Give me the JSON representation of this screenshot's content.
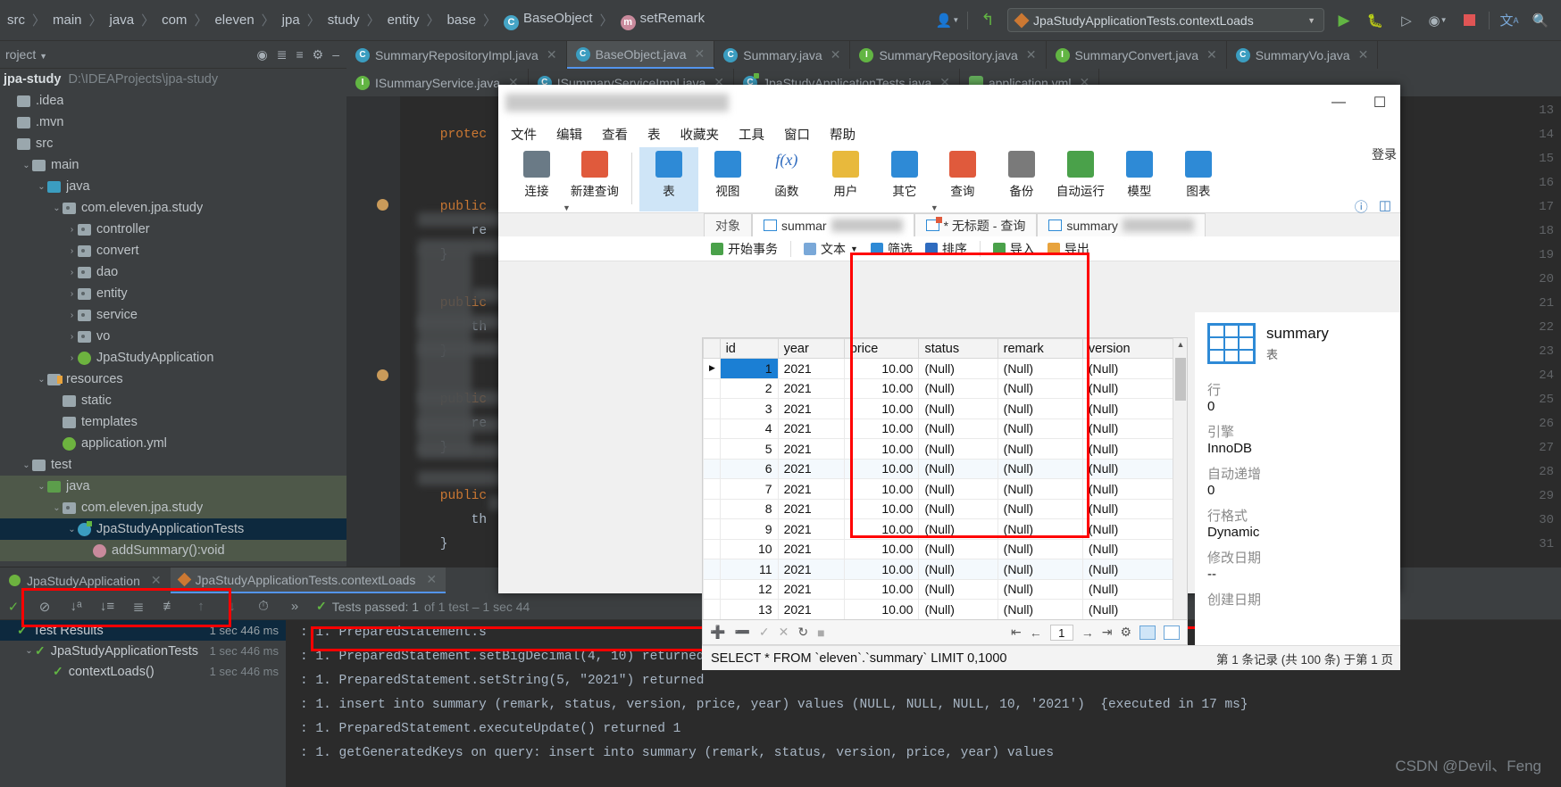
{
  "ide": {
    "breadcrumb": [
      {
        "label": "src",
        "icon": "none"
      },
      {
        "label": "main",
        "icon": "none"
      },
      {
        "label": "java",
        "icon": "none"
      },
      {
        "label": "com",
        "icon": "none"
      },
      {
        "label": "eleven",
        "icon": "none"
      },
      {
        "label": "jpa",
        "icon": "none"
      },
      {
        "label": "study",
        "icon": "none"
      },
      {
        "label": "entity",
        "icon": "none"
      },
      {
        "label": "base",
        "icon": "none"
      },
      {
        "label": "BaseObject",
        "icon": "class-icon"
      },
      {
        "label": "setRemark",
        "icon": "method-icon"
      }
    ],
    "run_config": "JpaStudyApplicationTests.contextLoads",
    "project_panel": {
      "title": "roject",
      "project_name": "jpa-study",
      "project_path": "D:\\IDEAProjects\\jpa-study"
    },
    "tree": [
      {
        "label": ".idea",
        "depth": 0,
        "arrow": "",
        "icon": "folder-grey"
      },
      {
        "label": ".mvn",
        "depth": 0,
        "arrow": "",
        "icon": "folder-grey"
      },
      {
        "label": "src",
        "depth": 0,
        "arrow": "",
        "icon": "folder-grey"
      },
      {
        "label": "main",
        "depth": 1,
        "arrow": "v",
        "icon": "folder-grey"
      },
      {
        "label": "java",
        "depth": 2,
        "arrow": "v",
        "icon": "folder-blue"
      },
      {
        "label": "com.eleven.jpa.study",
        "depth": 3,
        "arrow": "v",
        "icon": "package"
      },
      {
        "label": "controller",
        "depth": 4,
        "arrow": ">",
        "icon": "package"
      },
      {
        "label": "convert",
        "depth": 4,
        "arrow": ">",
        "icon": "package"
      },
      {
        "label": "dao",
        "depth": 4,
        "arrow": ">",
        "icon": "package"
      },
      {
        "label": "entity",
        "depth": 4,
        "arrow": ">",
        "icon": "package"
      },
      {
        "label": "service",
        "depth": 4,
        "arrow": ">",
        "icon": "package"
      },
      {
        "label": "vo",
        "depth": 4,
        "arrow": ">",
        "icon": "package"
      },
      {
        "label": "JpaStudyApplication",
        "depth": 4,
        "arrow": ">",
        "icon": "spring"
      },
      {
        "label": "resources",
        "depth": 2,
        "arrow": "v",
        "icon": "resources"
      },
      {
        "label": "static",
        "depth": 3,
        "arrow": "",
        "icon": "folder-grey"
      },
      {
        "label": "templates",
        "depth": 3,
        "arrow": "",
        "icon": "folder-grey"
      },
      {
        "label": "application.yml",
        "depth": 3,
        "arrow": "",
        "icon": "spring-yml"
      },
      {
        "label": "test",
        "depth": 1,
        "arrow": "v",
        "icon": "folder-grey"
      },
      {
        "label": "java",
        "depth": 2,
        "arrow": "v",
        "icon": "folder-green",
        "row_state": "sel-green"
      },
      {
        "label": "com.eleven.jpa.study",
        "depth": 3,
        "arrow": "v",
        "icon": "package",
        "row_state": "sel-green"
      },
      {
        "label": "JpaStudyApplicationTests",
        "depth": 4,
        "arrow": "v",
        "icon": "test-class",
        "row_state": "sel-blue"
      },
      {
        "label": "addSummary():void",
        "depth": 5,
        "arrow": "",
        "icon": "method",
        "row_state": "sel-green"
      }
    ],
    "tabs_row1": [
      {
        "label": "SummaryRepositoryImpl.java",
        "icon": "class-icon",
        "active": false
      },
      {
        "label": "BaseObject.java",
        "icon": "class-icon",
        "active": true
      },
      {
        "label": "Summary.java",
        "icon": "class-icon",
        "active": false
      },
      {
        "label": "SummaryRepository.java",
        "icon": "interface-icon",
        "active": false
      },
      {
        "label": "SummaryConvert.java",
        "icon": "interface-icon",
        "active": false
      },
      {
        "label": "SummaryVo.java",
        "icon": "class-icon",
        "active": false
      }
    ],
    "tabs_row2": [
      {
        "label": "ISummaryService.java",
        "icon": "interface-icon",
        "active": false
      },
      {
        "label": "ISummaryServiceImpl.java",
        "icon": "class-icon",
        "active": false
      },
      {
        "label": "JpaStudyApplicationTests.java",
        "icon": "test-class-icon",
        "active": false
      },
      {
        "label": "application.yml",
        "icon": "yml-icon",
        "active": false
      }
    ],
    "editor_lines": [
      {
        "num": "13",
        "text": ""
      },
      {
        "num": "14",
        "text": "    protec",
        "kw": "protec"
      },
      {
        "num": "15",
        "text": ""
      },
      {
        "num": "16",
        "text": ""
      },
      {
        "num": "17",
        "text": "    public",
        "kw": "public"
      },
      {
        "num": "18",
        "text": "        re"
      },
      {
        "num": "19",
        "text": "    }"
      },
      {
        "num": "20",
        "text": ""
      },
      {
        "num": "21",
        "text": "    public",
        "kw": "public"
      },
      {
        "num": "22",
        "text": "        th"
      },
      {
        "num": "23",
        "text": "    }"
      },
      {
        "num": "24",
        "text": ""
      },
      {
        "num": "25",
        "text": "    public",
        "kw": "public"
      },
      {
        "num": "26",
        "text": "        re"
      },
      {
        "num": "27",
        "text": "    }"
      },
      {
        "num": "28",
        "text": ""
      },
      {
        "num": "29",
        "text": "    public",
        "kw": "public"
      },
      {
        "num": "30",
        "text": "        th"
      },
      {
        "num": "31",
        "text": "    }"
      }
    ],
    "run_tabs": [
      {
        "label": "JpaStudyApplication",
        "active": false
      },
      {
        "label": "JpaStudyApplicationTests.contextLoads",
        "active": true
      }
    ],
    "tests_passed_text": "Tests passed: 1",
    "tests_passed_dim": "of 1 test – 1 sec 44",
    "test_tree": [
      {
        "label": "Test Results",
        "time": "1 sec 446 ms",
        "depth": 0,
        "selected": true,
        "arrow": ""
      },
      {
        "label": "JpaStudyApplicationTests",
        "time": "1 sec 446 ms",
        "depth": 1,
        "selected": false,
        "arrow": "v"
      },
      {
        "label": "contextLoads()",
        "time": "1 sec 446 ms",
        "depth": 2,
        "selected": false,
        "arrow": ""
      }
    ],
    "console_lines": [
      ": 1. PreparedStatement.s",
      ": 1. PreparedStatement.setBigDecimal(4, 10) returned",
      ": 1. PreparedStatement.setString(5, \"2021\") returned",
      ": 1. insert into summary (remark, status, version, price, year) values (NULL, NULL, NULL, 10, '2021')  {executed in 17 ms}",
      ": 1. PreparedStatement.executeUpdate() returned 1",
      ": 1. getGeneratedKeys on query: insert into summary (remark, status, version, price, year) values"
    ]
  },
  "navicat": {
    "menu": [
      "文件",
      "编辑",
      "查看",
      "表",
      "收藏夹",
      "工具",
      "窗口",
      "帮助"
    ],
    "menu_right": "登录",
    "ribbon": [
      {
        "label": "连接",
        "icon": "connect-icon",
        "caret": true,
        "selected": false
      },
      {
        "label": "新建查询",
        "icon": "new-query-icon",
        "caret": false,
        "selected": false
      },
      {
        "label": "表",
        "icon": "table-icon",
        "caret": false,
        "selected": true
      },
      {
        "label": "视图",
        "icon": "view-icon",
        "caret": false,
        "selected": false
      },
      {
        "label": "函数",
        "icon": "function-icon",
        "caret": false,
        "selected": false
      },
      {
        "label": "用户",
        "icon": "user-icon",
        "caret": false,
        "selected": false
      },
      {
        "label": "其它",
        "icon": "other-icon",
        "caret": true,
        "selected": false
      },
      {
        "label": "查询",
        "icon": "query-icon",
        "caret": false,
        "selected": false
      },
      {
        "label": "备份",
        "icon": "backup-icon",
        "caret": false,
        "selected": false
      },
      {
        "label": "自动运行",
        "icon": "autorun-icon",
        "caret": false,
        "selected": false
      },
      {
        "label": "模型",
        "icon": "model-icon",
        "caret": false,
        "selected": false
      },
      {
        "label": "图表",
        "icon": "chart-icon",
        "caret": false,
        "selected": false
      }
    ],
    "tabs": [
      {
        "label": "对象",
        "icon": "none",
        "active": false,
        "blur": false
      },
      {
        "label": "summar",
        "icon": "table-tab-icon",
        "active": true,
        "blur": true
      },
      {
        "label": "* 无标题 - 查询",
        "icon": "query-tab-icon",
        "active": false,
        "blur": false
      },
      {
        "label": "summary",
        "icon": "edit-tab-icon",
        "active": false,
        "blur": true
      }
    ],
    "actions": [
      {
        "label": "开始事务",
        "icon": "transaction-icon"
      },
      {
        "label": "文本",
        "icon": "text-icon",
        "caret": true
      },
      {
        "label": "筛选",
        "icon": "filter-icon"
      },
      {
        "label": "排序",
        "icon": "sort-icon"
      },
      {
        "label": "导入",
        "icon": "import-icon"
      },
      {
        "label": "导出",
        "icon": "export-icon"
      }
    ],
    "grid": {
      "columns": [
        "id",
        "year",
        "price",
        "status",
        "remark",
        "version"
      ],
      "rows": [
        {
          "id": "1",
          "year": "2021",
          "price": "10.00",
          "status": "(Null)",
          "remark": "(Null)",
          "version": "(Null)"
        },
        {
          "id": "2",
          "year": "2021",
          "price": "10.00",
          "status": "(Null)",
          "remark": "(Null)",
          "version": "(Null)"
        },
        {
          "id": "3",
          "year": "2021",
          "price": "10.00",
          "status": "(Null)",
          "remark": "(Null)",
          "version": "(Null)"
        },
        {
          "id": "4",
          "year": "2021",
          "price": "10.00",
          "status": "(Null)",
          "remark": "(Null)",
          "version": "(Null)"
        },
        {
          "id": "5",
          "year": "2021",
          "price": "10.00",
          "status": "(Null)",
          "remark": "(Null)",
          "version": "(Null)"
        },
        {
          "id": "6",
          "year": "2021",
          "price": "10.00",
          "status": "(Null)",
          "remark": "(Null)",
          "version": "(Null)"
        },
        {
          "id": "7",
          "year": "2021",
          "price": "10.00",
          "status": "(Null)",
          "remark": "(Null)",
          "version": "(Null)"
        },
        {
          "id": "8",
          "year": "2021",
          "price": "10.00",
          "status": "(Null)",
          "remark": "(Null)",
          "version": "(Null)"
        },
        {
          "id": "9",
          "year": "2021",
          "price": "10.00",
          "status": "(Null)",
          "remark": "(Null)",
          "version": "(Null)"
        },
        {
          "id": "10",
          "year": "2021",
          "price": "10.00",
          "status": "(Null)",
          "remark": "(Null)",
          "version": "(Null)"
        },
        {
          "id": "11",
          "year": "2021",
          "price": "10.00",
          "status": "(Null)",
          "remark": "(Null)",
          "version": "(Null)"
        },
        {
          "id": "12",
          "year": "2021",
          "price": "10.00",
          "status": "(Null)",
          "remark": "(Null)",
          "version": "(Null)"
        },
        {
          "id": "13",
          "year": "2021",
          "price": "10.00",
          "status": "(Null)",
          "remark": "(Null)",
          "version": "(Null)"
        }
      ]
    },
    "footer": {
      "page_value": "1",
      "buttons": [
        "add-row",
        "remove-row",
        "apply-change",
        "cancel-change",
        "refresh",
        "stop"
      ]
    },
    "sql_text": "SELECT * FROM `eleven`.`summary` LIMIT 0,1000",
    "info": {
      "title": "summary",
      "subtitle": "表",
      "pairs": [
        {
          "key": "行",
          "value": "0"
        },
        {
          "key": "引擎",
          "value": "InnoDB"
        },
        {
          "key": "自动递增",
          "value": "0"
        },
        {
          "key": "行格式",
          "value": "Dynamic"
        },
        {
          "key": "修改日期",
          "value": "--"
        },
        {
          "key": "创建日期",
          "value": ""
        }
      ]
    },
    "status_text": "第 1 条记录 (共 100 条) 于第 1 页"
  },
  "watermark": "CSDN @Devil、Feng",
  "colors": {
    "highlight_red": "#ff0000",
    "ide_bg": "#3c3f41",
    "editor_bg": "#2b2b2b",
    "accent_blue": "#1b7fd4",
    "pass_green": "#62b543"
  }
}
